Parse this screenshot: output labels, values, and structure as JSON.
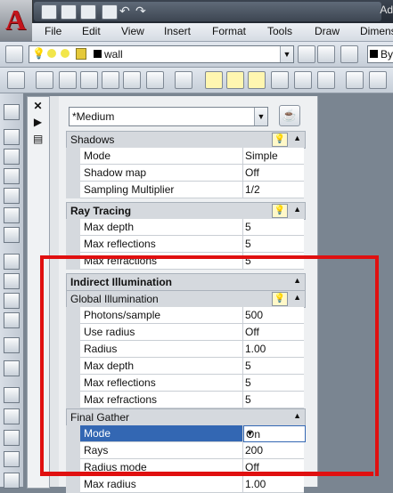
{
  "window": {
    "title": "Ad"
  },
  "menu": [
    "File",
    "Edit",
    "View",
    "Insert",
    "Format",
    "Tools",
    "Draw",
    "Dimens"
  ],
  "layer": {
    "name": "wall",
    "bycolor": "By"
  },
  "palette": {
    "preset": "*Medium",
    "sections": [
      {
        "id": "shadows",
        "label": "Shadows",
        "rows": [
          [
            "Mode",
            "Simple"
          ],
          [
            "Shadow map",
            "Off"
          ],
          [
            "Sampling Multiplier",
            "1/2"
          ]
        ]
      },
      {
        "id": "raytracing",
        "label": "Ray Tracing",
        "rows": [
          [
            "Max depth",
            "5"
          ],
          [
            "Max reflections",
            "5"
          ],
          [
            "Max refractions",
            "5"
          ]
        ]
      },
      {
        "id": "indirect",
        "label": "Indirect Illumination"
      },
      {
        "id": "global",
        "label": "Global Illumination",
        "rows": [
          [
            "Photons/sample",
            "500"
          ],
          [
            "Use radius",
            "Off"
          ],
          [
            "Radius",
            "1.00"
          ],
          [
            "Max depth",
            "5"
          ],
          [
            "Max reflections",
            "5"
          ],
          [
            "Max refractions",
            "5"
          ]
        ]
      },
      {
        "id": "finalgather",
        "label": "Final Gather",
        "rows": [
          [
            "Mode",
            "On"
          ],
          [
            "Rays",
            "200"
          ],
          [
            "Radius mode",
            "Off"
          ],
          [
            "Max radius",
            "1.00"
          ]
        ]
      }
    ]
  }
}
